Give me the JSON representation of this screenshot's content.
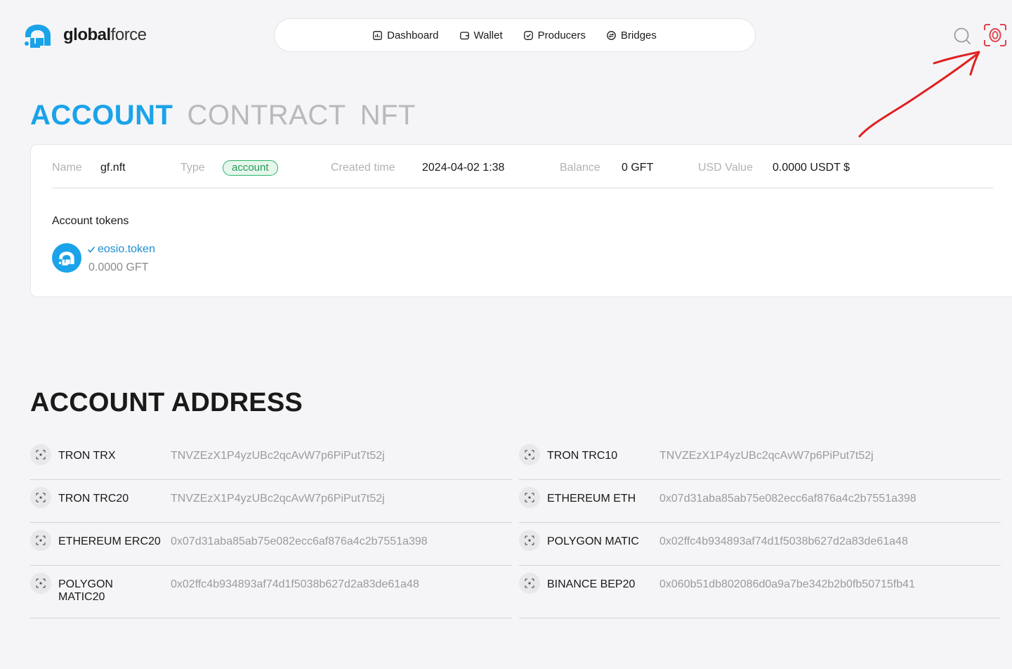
{
  "header": {
    "logo": {
      "bold": "global",
      "light": "force"
    },
    "nav": [
      {
        "label": "Dashboard",
        "icon": "dashboard-icon"
      },
      {
        "label": "Wallet",
        "icon": "wallet-icon"
      },
      {
        "label": "Producers",
        "icon": "check-badge-icon"
      },
      {
        "label": "Bridges",
        "icon": "bridge-icon"
      }
    ],
    "accent": "#1ba3ea"
  },
  "tabs": [
    {
      "label": "ACCOUNT",
      "active": true
    },
    {
      "label": "CONTRACT",
      "active": false
    },
    {
      "label": "NFT",
      "active": false
    }
  ],
  "account": {
    "name_label": "Name",
    "name": "gf.nft",
    "type_label": "Type",
    "type": "account",
    "created_label": "Created time",
    "created": "2024-04-02 1:38",
    "balance_label": "Balance",
    "balance": "0 GFT",
    "usd_label": "USD Value",
    "usd": "0.0000 USDT $",
    "tokens_title": "Account tokens",
    "token": {
      "name": "eosio.token",
      "amount": "0.0000 GFT"
    }
  },
  "addresses": {
    "title": "ACCOUNT ADDRESS",
    "left": [
      {
        "label": "TRON TRX",
        "value": "TNVZEzX1P4yzUBc2qcAvW7p6PiPut7t52j"
      },
      {
        "label": "TRON TRC20",
        "value": "TNVZEzX1P4yzUBc2qcAvW7p6PiPut7t52j"
      },
      {
        "label": "ETHEREUM ERC20",
        "value": "0x07d31aba85ab75e082ecc6af876a4c2b7551a398"
      },
      {
        "label": "POLYGON MATIC20",
        "value": "0x02ffc4b934893af74d1f5038b627d2a83de61a48"
      }
    ],
    "right": [
      {
        "label": "TRON TRC10",
        "value": "TNVZEzX1P4yzUBc2qcAvW7p6PiPut7t52j"
      },
      {
        "label": "ETHEREUM ETH",
        "value": "0x07d31aba85ab75e082ecc6af876a4c2b7551a398"
      },
      {
        "label": "POLYGON MATIC",
        "value": "0x02ffc4b934893af74d1f5038b627d2a83de61a48"
      },
      {
        "label": "BINANCE BEP20",
        "value": "0x060b51db802086d0a9a7be342b2b0fb50715fb41"
      }
    ]
  }
}
